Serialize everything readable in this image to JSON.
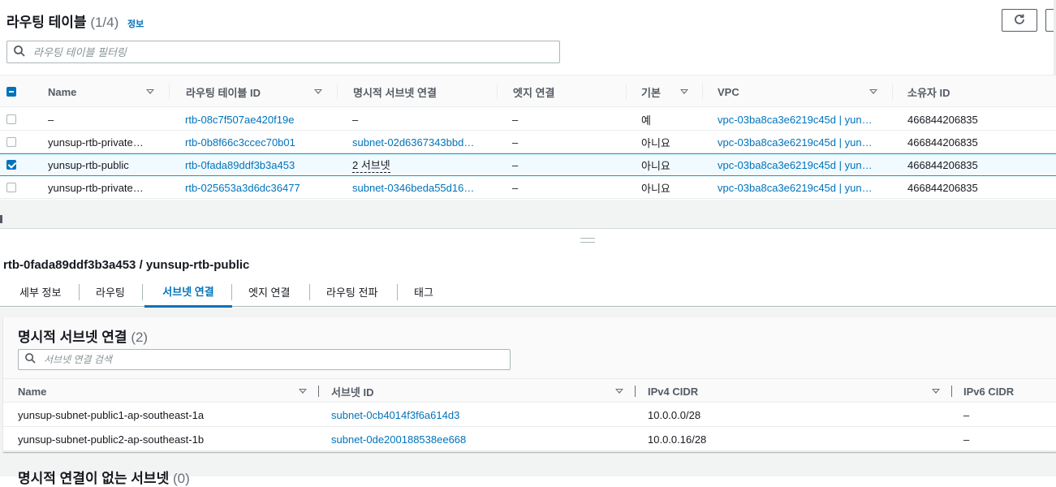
{
  "top": {
    "title": "라우팅 테이블",
    "count": "(1/4)",
    "info": "정보",
    "search_placeholder": "라우팅 테이블 필터링"
  },
  "table": {
    "columns": [
      "Name",
      "라우팅 테이블 ID",
      "명시적 서브넷 연결",
      "엣지 연결",
      "기본",
      "VPC",
      "소유자 ID"
    ],
    "rows": [
      {
        "name": "–",
        "id": "rtb-08c7f507ae420f19e",
        "subnet": "–",
        "edge": "–",
        "main": "예",
        "vpc": "vpc-03ba8ca3e6219c45d | yun…",
        "owner": "466844206835",
        "checked": false
      },
      {
        "name": "yunsup-rtb-private…",
        "id": "rtb-0b8f66c3ccec70b01",
        "subnet": "subnet-02d6367343bbd…",
        "edge": "–",
        "main": "아니요",
        "vpc": "vpc-03ba8ca3e6219c45d | yun…",
        "owner": "466844206835",
        "checked": false
      },
      {
        "name": "yunsup-rtb-public",
        "id": "rtb-0fada89ddf3b3a453",
        "subnet": "2 서브넷",
        "edge": "–",
        "main": "아니요",
        "vpc": "vpc-03ba8ca3e6219c45d | yun…",
        "owner": "466844206835",
        "checked": true
      },
      {
        "name": "yunsup-rtb-private…",
        "id": "rtb-025653a3d6dc36477",
        "subnet": "subnet-0346beda55d16…",
        "edge": "–",
        "main": "아니요",
        "vpc": "vpc-03ba8ca3e6219c45d | yun…",
        "owner": "466844206835",
        "checked": false
      }
    ]
  },
  "detail": {
    "title": "rtb-0fada89ddf3b3a453 / yunsup-rtb-public",
    "tabs": [
      "세부 정보",
      "라우팅",
      "서브넷 연결",
      "엣지 연결",
      "라우팅 전파",
      "태그"
    ],
    "active_tab": "서브넷 연결"
  },
  "explicit": {
    "title": "명시적 서브넷 연결",
    "count": "(2)",
    "search_placeholder": "서브넷 연결 검색",
    "columns": [
      "Name",
      "서브넷 ID",
      "IPv4 CIDR",
      "IPv6 CIDR"
    ],
    "rows": [
      {
        "name": "yunsup-subnet-public1-ap-southeast-1a",
        "subnet_id": "subnet-0cb4014f3f6a614d3",
        "ipv4": "10.0.0.0/28",
        "ipv6": "–"
      },
      {
        "name": "yunsup-subnet-public2-ap-southeast-1b",
        "subnet_id": "subnet-0de200188538ee668",
        "ipv4": "10.0.0.16/28",
        "ipv6": "–"
      }
    ]
  },
  "next_section": {
    "title": "명시적 연결이 없는 서브넷",
    "count": "(0)"
  },
  "colors": {
    "link": "#0073bb",
    "selected_row_bg": "#f1faff",
    "selected_row_border": "#00a1c9"
  },
  "icons": [
    "search-icon",
    "refresh-icon",
    "sort-icon",
    "checkbox-icon"
  ]
}
